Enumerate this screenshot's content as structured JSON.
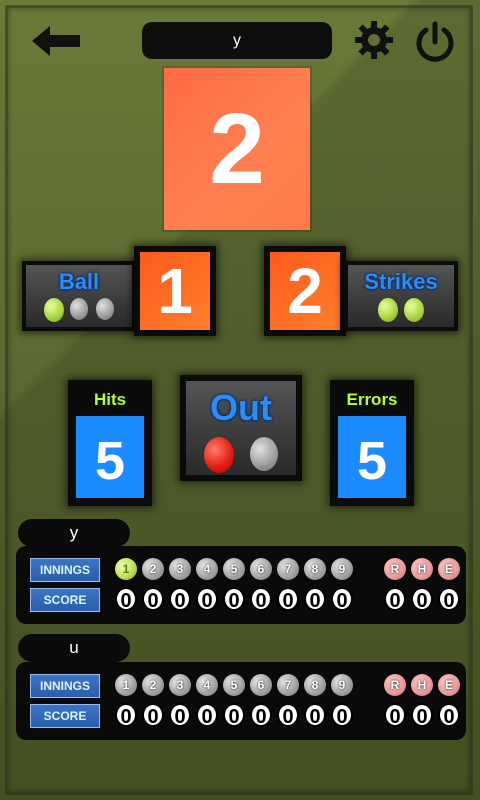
{
  "header": {
    "title": "y"
  },
  "center_score": {
    "value": "2"
  },
  "balls": {
    "label": "Ball",
    "count": "1",
    "indicators": [
      "green",
      "gray",
      "gray"
    ]
  },
  "strikes": {
    "label": "Strikes",
    "count": "2",
    "indicators": [
      "green",
      "green"
    ]
  },
  "outs": {
    "label": "Out",
    "indicators": [
      "red",
      "gray"
    ]
  },
  "hits": {
    "label": "Hits",
    "value": "5"
  },
  "errors": {
    "label": "Errors",
    "value": "5"
  },
  "teams": [
    {
      "name": "y",
      "innings_label": "INNINGS",
      "score_label": "SCORE",
      "innings": [
        "1",
        "2",
        "3",
        "4",
        "5",
        "6",
        "7",
        "8",
        "9"
      ],
      "current_inning": "1",
      "scores": [
        "0",
        "0",
        "0",
        "0",
        "0",
        "0",
        "0",
        "0",
        "0"
      ],
      "rhe_labels": [
        "R",
        "H",
        "E"
      ],
      "rhe_values": [
        "0",
        "0",
        "0"
      ]
    },
    {
      "name": "u",
      "innings_label": "INNINGS",
      "score_label": "SCORE",
      "innings": [
        "1",
        "2",
        "3",
        "4",
        "5",
        "6",
        "7",
        "8",
        "9"
      ],
      "current_inning": "",
      "scores": [
        "0",
        "0",
        "0",
        "0",
        "0",
        "0",
        "0",
        "0",
        "0"
      ],
      "rhe_labels": [
        "R",
        "H",
        "E"
      ],
      "rhe_values": [
        "0",
        "0",
        "0"
      ]
    }
  ],
  "icons": {
    "back": "back-arrow-icon",
    "settings": "gear-icon",
    "power": "power-icon"
  },
  "colors": {
    "accent_orange": "#ff7a48",
    "accent_blue": "#1a8cff",
    "background": "#58652f"
  }
}
